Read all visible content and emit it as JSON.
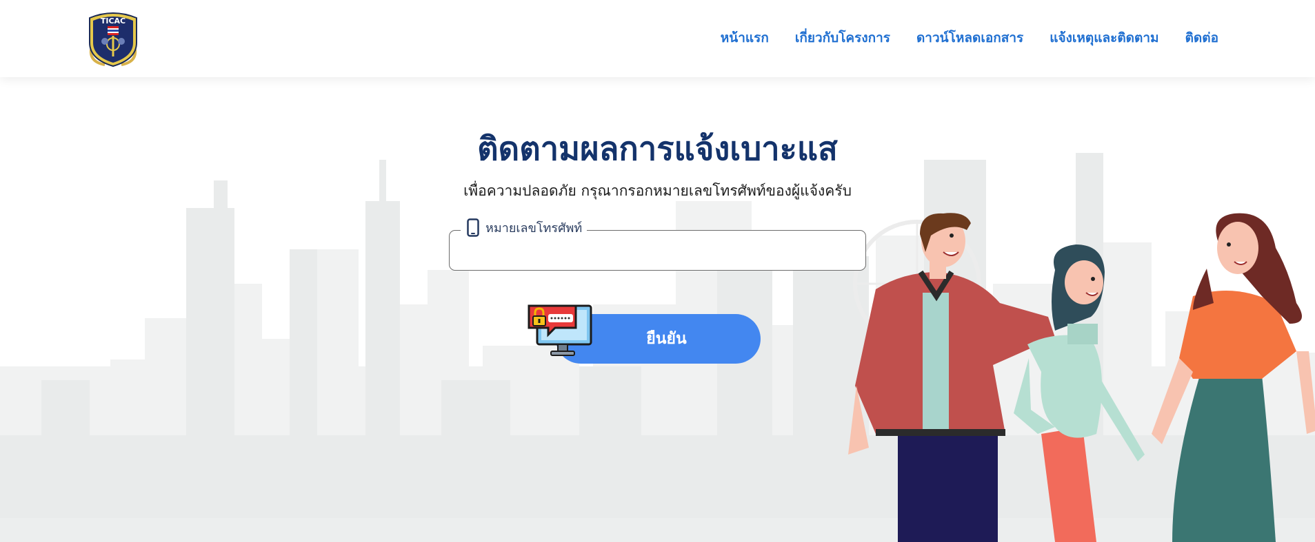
{
  "header": {
    "logo_text": "TICAC",
    "nav": [
      {
        "label": "หน้าแรก"
      },
      {
        "label": "เกี่ยวกับโครงการ"
      },
      {
        "label": "ดาวน์โหลดเอกสาร"
      },
      {
        "label": "แจ้งเหตุและติดตาม"
      },
      {
        "label": "ติดต่อ"
      }
    ]
  },
  "main": {
    "title": "ติดตามผลการแจ้งเบาะแส",
    "subtitle": "เพื่อความปลอดภัย กรุณากรอกหมายเลขโทรศัพท์ของผู้แจ้งครับ",
    "phone_field": {
      "label": "หมายเลขโทรศัพท์",
      "value": "",
      "icon": "mobile-phone-icon"
    },
    "confirm_button": {
      "label": "ยืนยัน",
      "icon": "secure-monitor-icon"
    }
  },
  "colors": {
    "nav_link": "#1f6fd1",
    "title": "#14336b",
    "button": "#4387f0",
    "city_silhouette": "#eceeee"
  }
}
